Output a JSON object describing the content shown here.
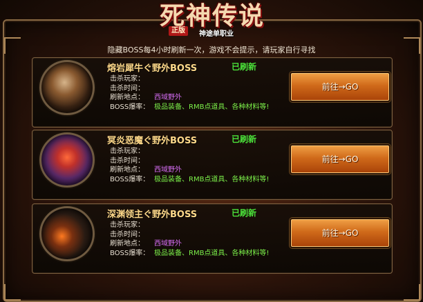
{
  "header": {
    "title": "死神传说",
    "badge": "正版",
    "subtitle": "神途单职业"
  },
  "notice": "隐藏BOSS每4小时刷新一次，游戏不会提示，请玩家自行寻找",
  "labels": {
    "killer": "击杀玩家：",
    "kill_time": "击杀时间：",
    "location": "刷新地点：",
    "drop": "BOSS爆率："
  },
  "bosses": [
    {
      "name": "熔岩犀牛ぐ野外BOSS",
      "status": "已刷新",
      "location": "西域野外",
      "drop": "极品装备、RMB点道具、各种材料等!",
      "button": "前往→GO"
    },
    {
      "name": "冥炎恶魔ぐ野外BOSS",
      "status": "已刷新",
      "location": "西域野外",
      "drop": "极品装备、RMB点道具、各种材料等!",
      "button": "前往→GO"
    },
    {
      "name": "深渊领主ぐ野外BOSS",
      "status": "已刷新",
      "location": "西域野外",
      "drop": "极品装备、RMB点道具、各种材料等!",
      "button": "前往→GO"
    }
  ],
  "colors": {
    "status_green": "#4be23a",
    "location_purple": "#d36cf0",
    "drop_green": "#7cf04a",
    "button_orange": "#d06a1a"
  }
}
